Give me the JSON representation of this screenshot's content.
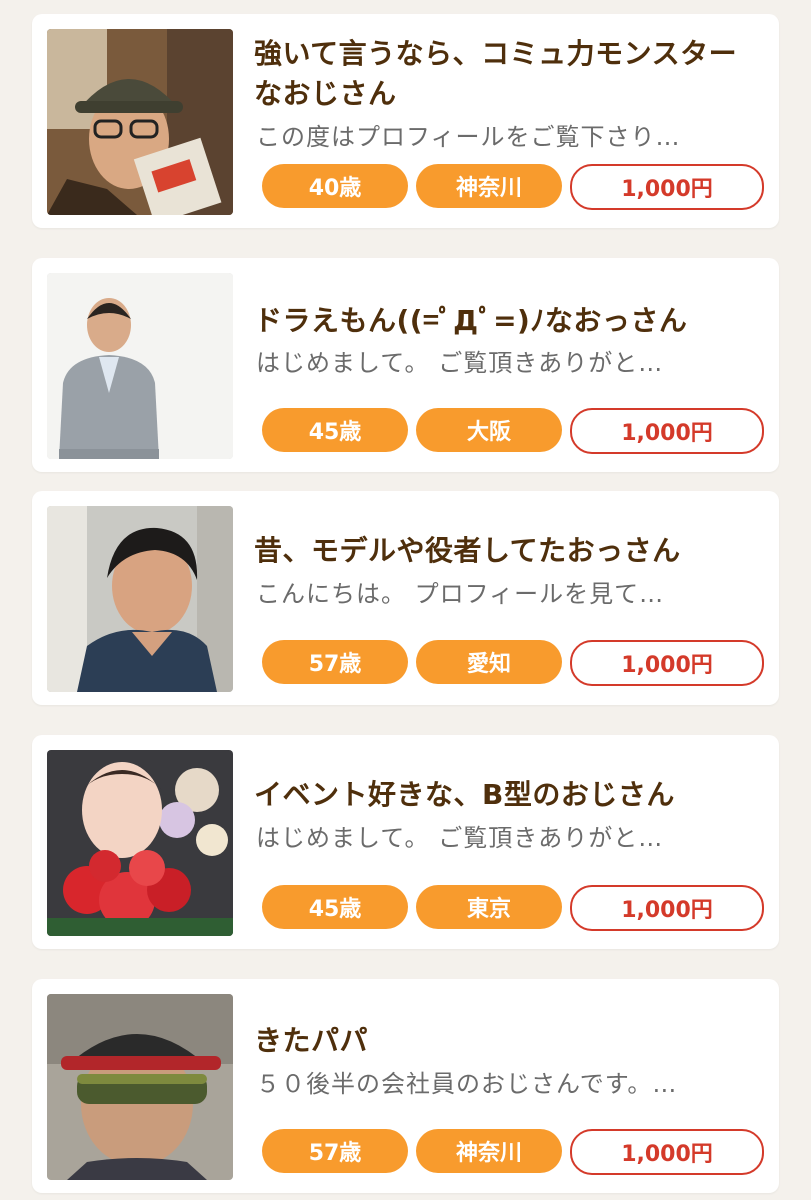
{
  "profiles": [
    {
      "title": "強いて言うなら、コミュ力モンスターなおじさん",
      "excerpt": "この度はプロフィールをご覧下さり…",
      "age": "40歳",
      "area": "神奈川",
      "price": "1,000円"
    },
    {
      "title": "ドラえもん((=ﾟДﾟ=)ﾉなおっさん",
      "excerpt": "はじめまして。 ご覧頂きありがと…",
      "age": "45歳",
      "area": "大阪",
      "price": "1,000円"
    },
    {
      "title": "昔、モデルや役者してたおっさん",
      "excerpt": "こんにちは。 プロフィールを見て…",
      "age": "57歳",
      "area": "愛知",
      "price": "1,000円"
    },
    {
      "title": "イベント好きな、B型のおじさん",
      "excerpt": "はじめまして。 ご覧頂きありがと…",
      "age": "45歳",
      "area": "東京",
      "price": "1,000円"
    },
    {
      "title": "きたパパ",
      "excerpt": "５０後半の会社員のおじさんです。…",
      "age": "57歳",
      "area": "神奈川",
      "price": "1,000円"
    }
  ],
  "colors": {
    "page_background": "#f4f1ec",
    "title": "#4f2f0c",
    "tag": "#f89b2d",
    "price_border": "#d43a2a"
  }
}
